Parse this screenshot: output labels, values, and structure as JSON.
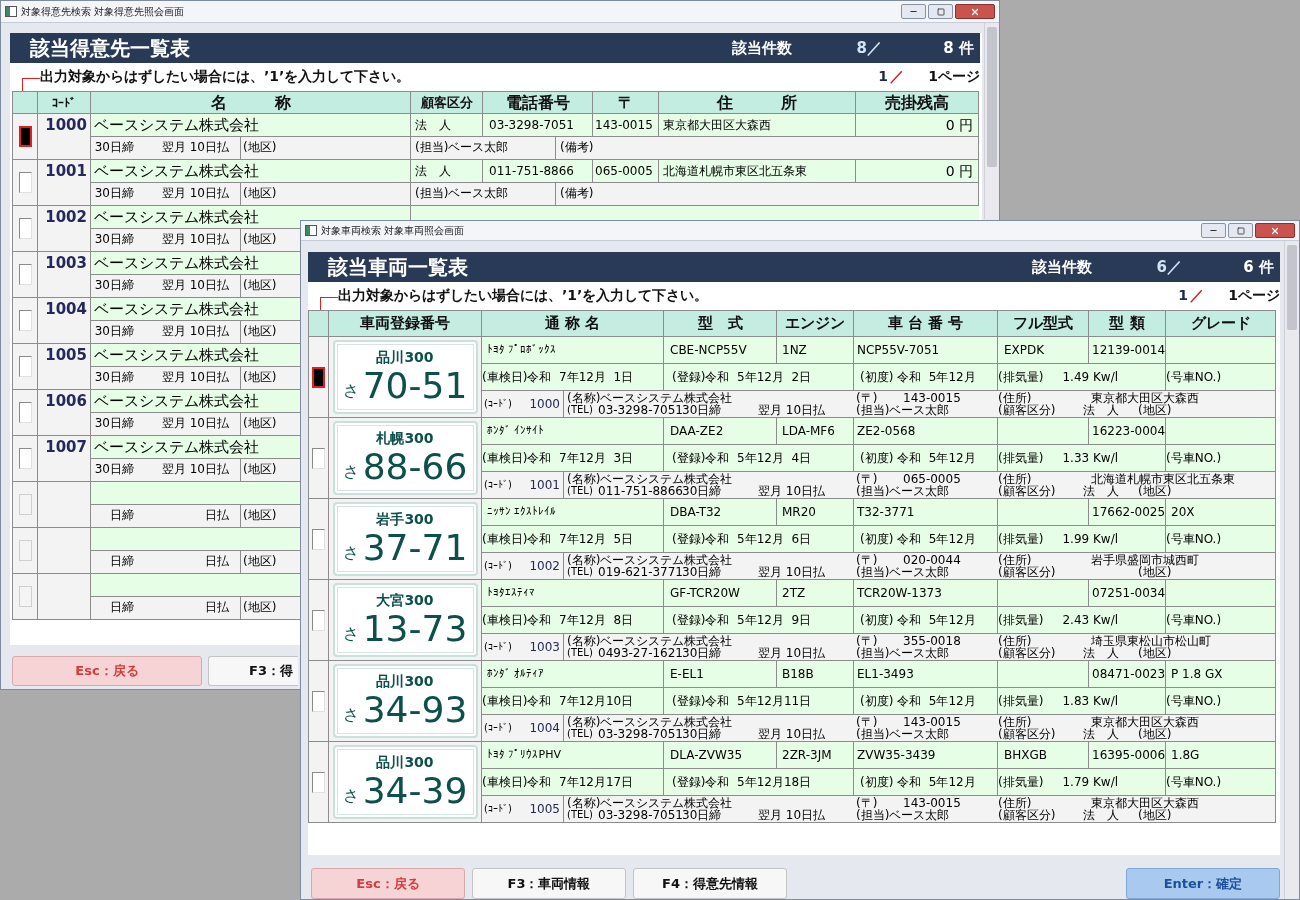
{
  "back_window": {
    "title": "対象得意先検索 対象得意先照会画面",
    "heading": "該当得意先一覧表",
    "count_label": "該当件数",
    "count": "8／",
    "total": "8 件",
    "instruction": "出力対象からはずしたい場合には、’1’を入力して下さい。",
    "page_current": "1",
    "page_separator": "／",
    "page_total": "1ページ",
    "columns": [
      "ｺｰﾄﾞ",
      "名　　　称",
      "顧客区分",
      "電話番号",
      "〒",
      "住　　　所",
      "売掛残高"
    ],
    "rows": [
      {
        "selected": true,
        "disabled": false,
        "code": "1000",
        "name": "ベースシステム株式会社",
        "category": "法　人",
        "phone": "03-3298-7051",
        "zip": "143-0015",
        "address": "東京都大田区大森西",
        "balance": "0 円",
        "closing": "30日締",
        "payment": "翌月 10日払",
        "area": "(地区)",
        "staff": "(担当)ベース太郎",
        "note": "(備考)"
      },
      {
        "selected": false,
        "disabled": false,
        "code": "1001",
        "name": "ベースシステム株式会社",
        "category": "法　人",
        "phone": "011-751-8866",
        "zip": "065-0005",
        "address": "北海道札幌市東区北五条東",
        "balance": "0 円",
        "closing": "30日締",
        "payment": "翌月 10日払",
        "area": "(地区)",
        "staff": "(担当)ベース太郎",
        "note": "(備考)"
      },
      {
        "selected": false,
        "disabled": false,
        "code": "1002",
        "name": "ベースシステム株式会社",
        "closing": "30日締",
        "payment": "翌月 10日払",
        "area": "(地区)"
      },
      {
        "selected": false,
        "disabled": false,
        "code": "1003",
        "name": "ベースシステム株式会社",
        "closing": "30日締",
        "payment": "翌月 10日払",
        "area": "(地区)"
      },
      {
        "selected": false,
        "disabled": false,
        "code": "1004",
        "name": "ベースシステム株式会社",
        "closing": "30日締",
        "payment": "翌月 10日払",
        "area": "(地区)"
      },
      {
        "selected": false,
        "disabled": false,
        "code": "1005",
        "name": "ベースシステム株式会社",
        "closing": "30日締",
        "payment": "翌月 10日払",
        "area": "(地区)"
      },
      {
        "selected": false,
        "disabled": false,
        "code": "1006",
        "name": "ベースシステム株式会社",
        "closing": "30日締",
        "payment": "翌月 10日払",
        "area": "(地区)"
      },
      {
        "selected": false,
        "disabled": false,
        "code": "1007",
        "name": "ベースシステム株式会社",
        "closing": "30日締",
        "payment": "翌月 10日払",
        "area": "(地区)"
      },
      {
        "selected": false,
        "disabled": true,
        "closing": "日締",
        "payment": "日払",
        "area": "(地区)"
      },
      {
        "selected": false,
        "disabled": true,
        "closing": "日締",
        "payment": "日払",
        "area": "(地区)"
      },
      {
        "selected": false,
        "disabled": true,
        "closing": "日締",
        "payment": "日払",
        "area": "(地区)"
      }
    ],
    "buttons": [
      {
        "label": "Esc：戻る",
        "kind": "back"
      },
      {
        "label": "F3：得",
        "kind": "normal"
      }
    ]
  },
  "front_window": {
    "title": "対象車両検索 対象車両照会画面",
    "heading": "該当車両一覧表",
    "count_label": "該当件数",
    "count": "6／",
    "total": "6 件",
    "instruction": "出力対象からはずしたい場合には、’1’を入力して下さい。",
    "page_current": "1",
    "page_separator": "／",
    "page_total": "1ページ",
    "columns": [
      "車両登録番号",
      "通 称 名",
      "型　式",
      "エンジン",
      "車 台 番 号",
      "フル型式",
      "型 類",
      "グレード"
    ],
    "rows": [
      {
        "selected": true,
        "disabled": false,
        "plate": {
          "region": "品川300",
          "kana": "さ",
          "number": "70-51"
        },
        "name": "ﾄﾖﾀ ﾌﾟﾛﾎﾞｯｸｽ",
        "model": "CBE-NCP55V",
        "engine": "1NZ",
        "chassis": "NCP55V-7051",
        "full_model": "EXPDK",
        "type_class": "12139-0014",
        "inspection": "(車検日)令和  7年12月  1日",
        "registration": "(登録)令和  5年12月  2日",
        "first_registration": "(初度) 令和  5年12月",
        "displacement": "(排気量)     1.49 Kw/l",
        "car_no": "(号車NO.)",
        "code_label": "(ｺｰﾄﾞ)",
        "customer_code": "1000",
        "customer_name": "(名称)ベースシステム株式会社",
        "zip_label": "(〒)",
        "zip": "143-0015",
        "address_label": "(住所)",
        "address": "東京都大田区大森西",
        "tel_label": "(TEL)",
        "tel": "03-3298-7051",
        "closing": "30日締",
        "payment": "翌月 10日払",
        "staff": "(担当)ベース太郎",
        "category_label": "(顧客区分)",
        "category": "法　人",
        "area": "(地区)"
      },
      {
        "selected": false,
        "disabled": false,
        "plate": {
          "region": "札幌300",
          "kana": "さ",
          "number": "88-66"
        },
        "name": "ﾎﾝﾀﾞ ｲﾝｻｲﾄ",
        "model": "DAA-ZE2",
        "engine": "LDA-MF6",
        "chassis": "ZE2-0568",
        "type_class": "16223-0004",
        "inspection": "(車検日)令和  7年12月  3日",
        "registration": "(登録)令和  5年12月  4日",
        "first_registration": "(初度) 令和  5年12月",
        "displacement": "(排気量)     1.33 Kw/l",
        "car_no": "(号車NO.)",
        "code_label": "(ｺｰﾄﾞ)",
        "customer_code": "1001",
        "customer_name": "(名称)ベースシステム株式会社",
        "zip_label": "(〒)",
        "zip": "065-0005",
        "address_label": "(住所)",
        "address": "北海道札幌市東区北五条東",
        "tel_label": "(TEL)",
        "tel": "011-751-8866",
        "closing": "30日締",
        "payment": "翌月 10日払",
        "staff": "(担当)ベース太郎",
        "category_label": "(顧客区分)",
        "category": "法　人",
        "area": "(地区)"
      },
      {
        "selected": false,
        "disabled": false,
        "plate": {
          "region": "岩手300",
          "kana": "さ",
          "number": "37-71"
        },
        "name": "ﾆｯｻﾝ ｴｸｽﾄﾚｲﾙ",
        "model": "DBA-T32",
        "engine": "MR20",
        "chassis": "T32-3771",
        "type_class": "17662-0025",
        "grade": "20X",
        "inspection": "(車検日)令和  7年12月  5日",
        "registration": "(登録)令和  5年12月  6日",
        "first_registration": "(初度) 令和  5年12月",
        "displacement": "(排気量)     1.99 Kw/l",
        "car_no": "(号車NO.)",
        "code_label": "(ｺｰﾄﾞ)",
        "customer_code": "1002",
        "customer_name": "(名称)ベースシステム株式会社",
        "zip_label": "(〒)",
        "zip": "020-0044",
        "address_label": "(住所)",
        "address": "岩手県盛岡市城西町",
        "tel_label": "(TEL)",
        "tel": "019-621-3771",
        "closing": "30日締",
        "payment": "翌月 10日払",
        "staff": "(担当)ベース太郎",
        "category_label": "(顧客区分)",
        "area": "(地区)"
      },
      {
        "selected": false,
        "disabled": false,
        "plate": {
          "region": "大宮300",
          "kana": "さ",
          "number": "13-73"
        },
        "name": "ﾄﾖﾀｴｽﾃｨﾏ",
        "model": "GF-TCR20W",
        "engine": "2TZ",
        "chassis": "TCR20W-1373",
        "type_class": "07251-0034",
        "inspection": "(車検日)令和  7年12月  8日",
        "registration": "(登録)令和  5年12月  9日",
        "first_registration": "(初度) 令和  5年12月",
        "displacement": "(排気量)     2.43 Kw/l",
        "car_no": "(号車NO.)",
        "code_label": "(ｺｰﾄﾞ)",
        "customer_code": "1003",
        "customer_name": "(名称)ベースシステム株式会社",
        "zip_label": "(〒)",
        "zip": "355-0018",
        "address_label": "(住所)",
        "address": "埼玉県東松山市松山町",
        "tel_label": "(TEL)",
        "tel": "0493-27-1621",
        "closing": "30日締",
        "payment": "翌月 10日払",
        "staff": "(担当)ベース太郎",
        "category_label": "(顧客区分)",
        "category": "法　人",
        "area": "(地区)"
      },
      {
        "selected": false,
        "disabled": false,
        "plate": {
          "region": "品川300",
          "kana": "さ",
          "number": "34-93"
        },
        "name": "ﾎﾝﾀﾞ ｵﾙﾃｨｱ",
        "model": "E-EL1",
        "engine": "B18B",
        "chassis": "EL1-3493",
        "type_class": "08471-0023",
        "grade": "P 1.8 GX",
        "inspection": "(車検日)令和  7年12月10日",
        "registration": "(登録)令和  5年12月11日",
        "first_registration": "(初度) 令和  5年12月",
        "displacement": "(排気量)     1.83 Kw/l",
        "car_no": "(号車NO.)",
        "code_label": "(ｺｰﾄﾞ)",
        "customer_code": "1004",
        "customer_name": "(名称)ベースシステム株式会社",
        "zip_label": "(〒)",
        "zip": "143-0015",
        "address_label": "(住所)",
        "address": "東京都大田区大森西",
        "tel_label": "(TEL)",
        "tel": "03-3298-7051",
        "closing": "30日締",
        "payment": "翌月 10日払",
        "staff": "(担当)ベース太郎",
        "category_label": "(顧客区分)",
        "category": "法　人",
        "area": "(地区)"
      },
      {
        "selected": false,
        "disabled": false,
        "plate": {
          "region": "品川300",
          "kana": "さ",
          "number": "34-39"
        },
        "name": "ﾄﾖﾀ ﾌﾟﾘｳｽPHV",
        "model": "DLA-ZVW35",
        "engine": "2ZR-3JM",
        "chassis": "ZVW35-3439",
        "full_model": "BHXGB",
        "type_class": "16395-0006",
        "grade": "1.8G",
        "inspection": "(車検日)令和  7年12月17日",
        "registration": "(登録)令和  5年12月18日",
        "first_registration": "(初度) 令和  5年12月",
        "displacement": "(排気量)     1.79 Kw/l",
        "car_no": "(号車NO.)",
        "code_label": "(ｺｰﾄﾞ)",
        "customer_code": "1005",
        "customer_name": "(名称)ベースシステム株式会社",
        "zip_label": "(〒)",
        "zip": "143-0015",
        "address_label": "(住所)",
        "address": "東京都大田区大森西",
        "tel_label": "(TEL)",
        "tel": "03-3298-7051",
        "closing": "30日締",
        "payment": "翌月 10日払",
        "staff": "(担当)ベース太郎",
        "category_label": "(顧客区分)",
        "category": "法　人",
        "area": "(地区)"
      }
    ],
    "buttons": [
      {
        "label": "Esc：戻る",
        "kind": "back"
      },
      {
        "label": "F3：車両情報",
        "kind": "normal"
      },
      {
        "label": "F4：得意先情報",
        "kind": "normal"
      },
      {
        "label": "Enter：確定",
        "kind": "confirm"
      }
    ]
  }
}
